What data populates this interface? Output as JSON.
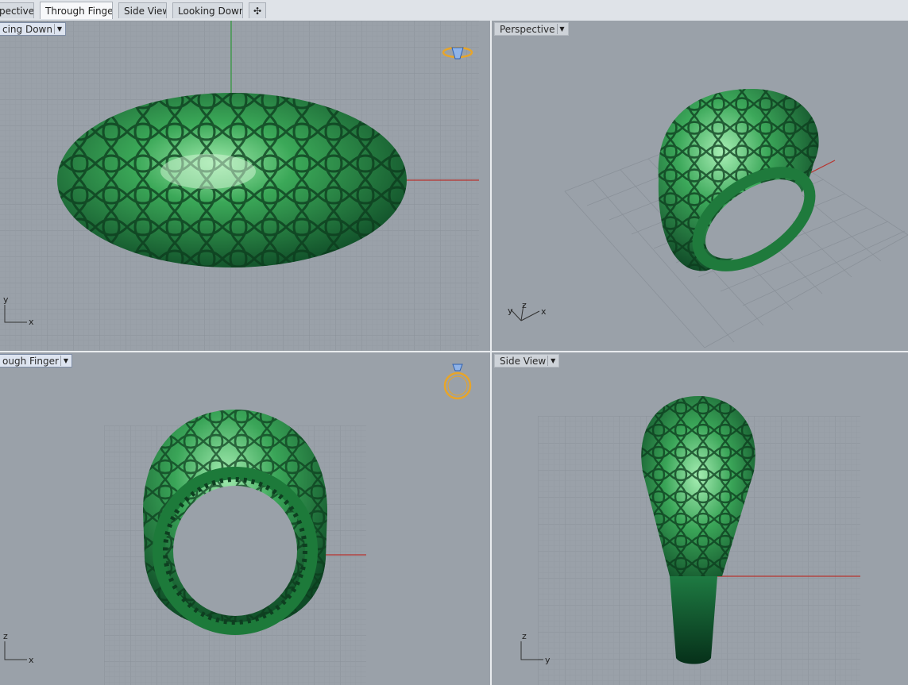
{
  "tabs": [
    {
      "label": "Perspective",
      "shown": "pective",
      "active": false
    },
    {
      "label": "Through Finger",
      "active": true
    },
    {
      "label": "Side View",
      "active": false
    },
    {
      "label": "Looking Down",
      "active": false
    }
  ],
  "add_tab_icon": "plus-icon",
  "viewports": {
    "top_left": {
      "title": "Looking Down",
      "shown_title": "cing Down",
      "axis_labels": [
        "y",
        "x"
      ]
    },
    "top_right": {
      "title": "Perspective",
      "axis_labels": [
        "y",
        "z",
        "x"
      ]
    },
    "bottom_left": {
      "title": "Through Finger",
      "shown_title": "ough Finger",
      "axis_labels": [
        "z",
        "x"
      ]
    },
    "bottom_right": {
      "title": "Side View",
      "axis_labels": [
        "z",
        "y"
      ]
    }
  },
  "colors": {
    "viewport_bg": "#9aa1a9",
    "grid": "#8d949c",
    "ring_green": "#2e9a4a",
    "axis_x_red": "#b8332e",
    "axis_y_green": "#2f9a3a",
    "gem_icon_orange": "#e7a52a"
  },
  "icons": [
    "ring-top-view-icon",
    "ring-front-view-icon",
    "dropdown-arrow-icon"
  ]
}
